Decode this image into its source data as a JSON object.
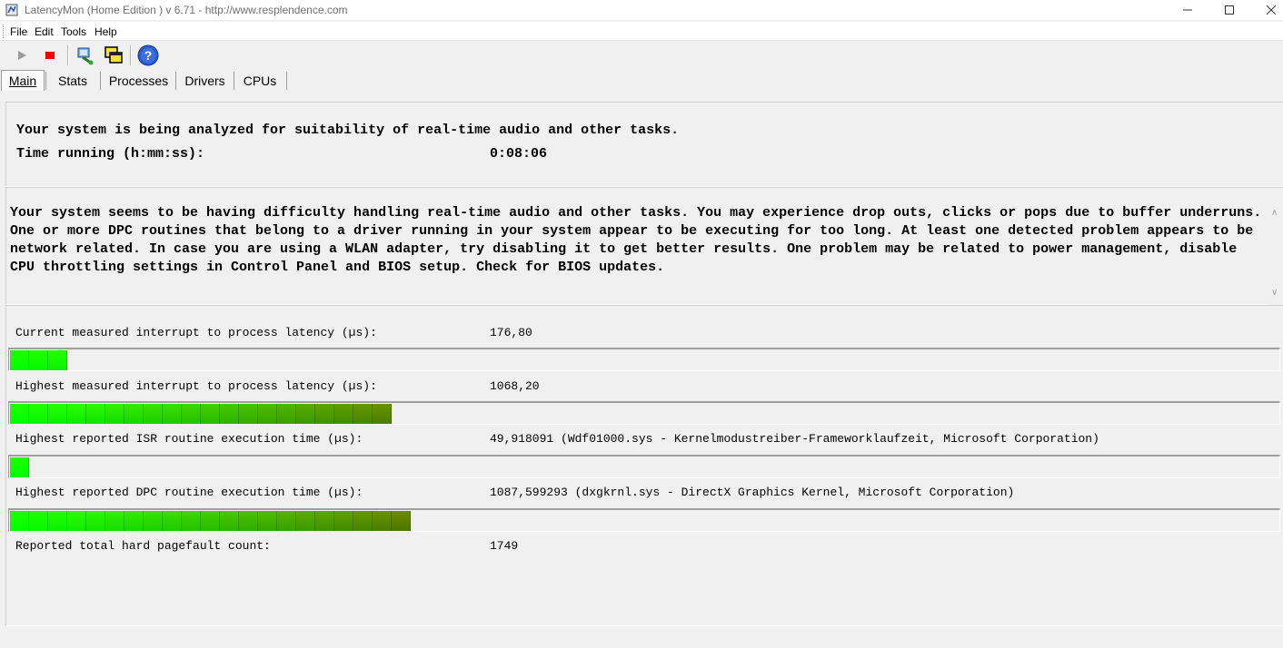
{
  "window": {
    "title": "LatencyMon  (Home Edition )  v 6.71 - http://www.resplendence.com"
  },
  "menu": [
    "File",
    "Edit",
    "Tools",
    "Help"
  ],
  "toolbar": {
    "icons": [
      "play-icon",
      "stop-icon",
      "driver-icon",
      "window-icon",
      "help-icon"
    ]
  },
  "tabs": [
    {
      "label": "Main",
      "active": true
    },
    {
      "label": "Stats",
      "active": false
    },
    {
      "label": "Processes",
      "active": false
    },
    {
      "label": "Drivers",
      "active": false
    },
    {
      "label": "CPUs",
      "active": false
    }
  ],
  "status": {
    "analyzing": "Your system is being analyzed for suitability of real-time audio and other tasks.",
    "time_label": "Time running (h:mm:ss):",
    "time_value": "0:08:06"
  },
  "message": "Your system seems to be having difficulty handling real-time audio and other tasks. You may experience drop outs, clicks or pops due to buffer underruns. One or more DPC routines that belong to a driver running in your system appear to be executing for too long. At least one detected problem appears to be network related. In case you are using a WLAN adapter, try disabling it to get better results. One problem may be related to power management, disable CPU throttling settings in Control Panel and BIOS setup. Check for BIOS updates.",
  "metrics": [
    {
      "label": "Current measured interrupt to process latency (µs):",
      "value": "176,80",
      "bar_fraction": 0.044
    },
    {
      "label": "Highest measured interrupt to process latency (µs):",
      "value": "1068,20",
      "bar_fraction": 0.3
    },
    {
      "label": "Highest reported ISR routine execution time (µs):",
      "value": "49,918091  (Wdf01000.sys - Kernelmodustreiber-Frameworklaufzeit, Microsoft Corporation)",
      "bar_fraction": 0.015
    },
    {
      "label": "Highest reported DPC routine execution time (µs):",
      "value": "1087,599293  (dxgkrnl.sys - DirectX Graphics Kernel, Microsoft Corporation)",
      "bar_fraction": 0.314
    },
    {
      "label": "Reported total hard pagefault count:",
      "value": "1749"
    }
  ],
  "colors": {
    "bar_start": "#00ff00",
    "bar_end": "#556b00"
  }
}
